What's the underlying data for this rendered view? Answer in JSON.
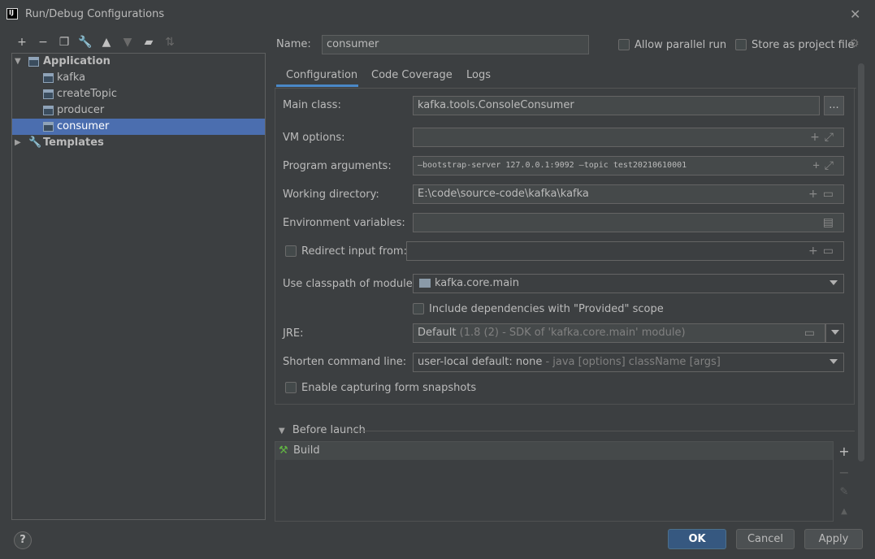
{
  "window": {
    "title": "Run/Debug Configurations",
    "icon_text": "IJ"
  },
  "toolbar": {
    "icons": [
      "add-icon",
      "remove-icon",
      "copy-icon",
      "wrench-icon",
      "move-up-icon",
      "move-down-icon",
      "folder-add-icon",
      "sort-icon"
    ]
  },
  "tree": {
    "application": "Application",
    "items": [
      {
        "label": "kafka"
      },
      {
        "label": "createTopic"
      },
      {
        "label": "producer"
      },
      {
        "label": "consumer"
      }
    ],
    "templates": "Templates"
  },
  "header": {
    "name_label": "Name:",
    "name_value": "consumer",
    "allow_parallel": "Allow parallel run",
    "store_as_project": "Store as project file"
  },
  "tabs": [
    {
      "label": "Configuration"
    },
    {
      "label": "Code Coverage"
    },
    {
      "label": "Logs"
    }
  ],
  "form": {
    "main_class_label": "Main class:",
    "main_class_value": "kafka.tools.ConsoleConsumer",
    "browse_label": "...",
    "vm_options_label": "VM options:",
    "vm_options_value": "",
    "program_args_label": "Program arguments:",
    "program_args_value": "—bootstrap-server 127.0.0.1:9092 —topic test20210610001",
    "working_dir_label": "Working directory:",
    "working_dir_value": "E:\\code\\source-code\\kafka\\kafka",
    "env_vars_label": "Environment variables:",
    "env_vars_value": "",
    "redirect_label": "Redirect input from:",
    "classpath_label": "Use classpath of module:",
    "classpath_value": "kafka.core.main",
    "include_deps_label": "Include dependencies with \"Provided\" scope",
    "jre_label": "JRE:",
    "jre_value": "Default",
    "jre_detail": "(1.8 (2) - SDK of 'kafka.core.main' module)",
    "shorten_label": "Shorten command line:",
    "shorten_value": "user-local default: none",
    "shorten_detail": " - java [options] className [args]",
    "snapshots_label": "Enable capturing form snapshots"
  },
  "before_launch": {
    "header": "Before launch",
    "items": [
      {
        "label": "Build"
      }
    ]
  },
  "buttons": {
    "help": "?",
    "ok": "OK",
    "cancel": "Cancel",
    "apply": "Apply"
  }
}
